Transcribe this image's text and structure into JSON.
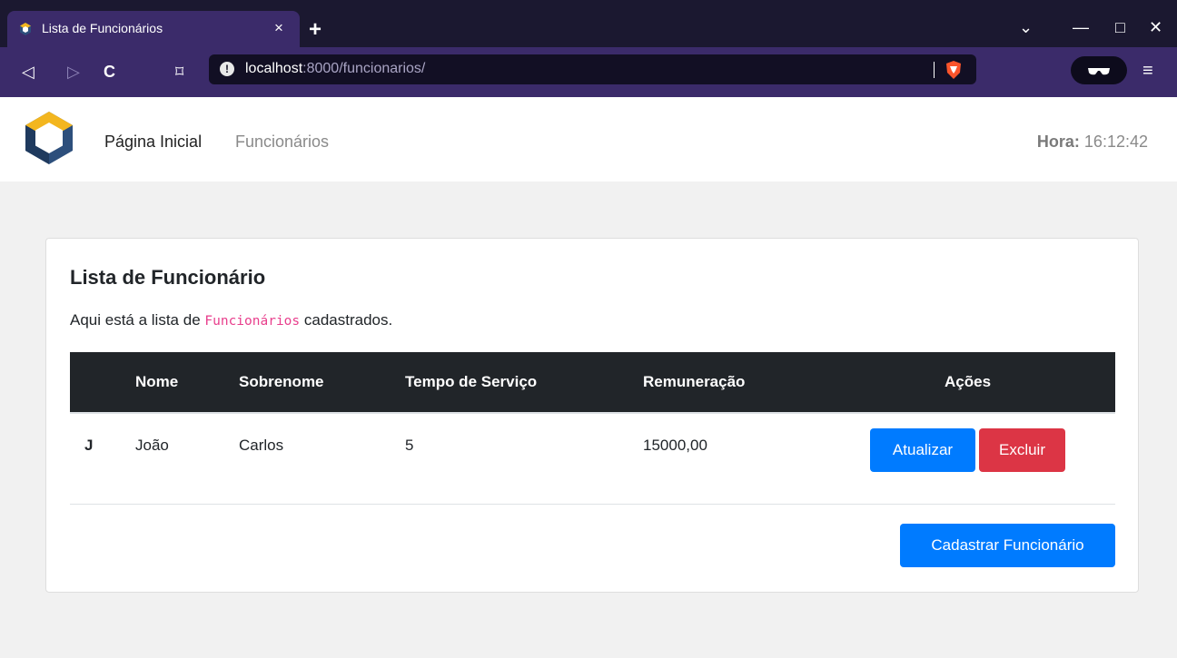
{
  "browser": {
    "tab_title": "Lista de Funcionários",
    "tab_close": "×",
    "new_tab": "+",
    "url_host": "localhost",
    "url_rest": ":8000/funcionarios/",
    "url_info": "!",
    "nav_back": "◁",
    "nav_forward": "▷",
    "nav_reload": "C",
    "nav_bookmark": "⌑",
    "win_tabsearch": "⌄",
    "win_minimize": "—",
    "win_maximize": "□",
    "win_close": "✕",
    "menu": "≡",
    "colors": {
      "tabbar": "#1b1830",
      "toolbar": "#3b2b6a",
      "urlbar": "#120f24",
      "brave": "#fb542b"
    }
  },
  "header": {
    "nav_home": "Página Inicial",
    "nav_funcionarios": "Funcionários",
    "clock_label": "Hora:",
    "clock_value": "16:12:42"
  },
  "card": {
    "title": "Lista de Funcionário",
    "text_before": "Aqui está a lista de ",
    "text_code": "Funcionários",
    "text_after": " cadastrados.",
    "table": {
      "headers": [
        "",
        "Nome",
        "Sobrenome",
        "Tempo de Serviço",
        "Remuneração",
        "Ações"
      ],
      "rows": [
        {
          "initial": "J",
          "nome": "João",
          "sobrenome": "Carlos",
          "tempo": "5",
          "remuneracao": "15000,00"
        }
      ]
    },
    "update_button": "Atualizar",
    "delete_button": "Excluir",
    "register_button": "Cadastrar Funcionário",
    "colors": {
      "primary": "#007bff",
      "danger": "#dc3545",
      "table_head": "#212529",
      "code": "#e83e8c"
    }
  }
}
